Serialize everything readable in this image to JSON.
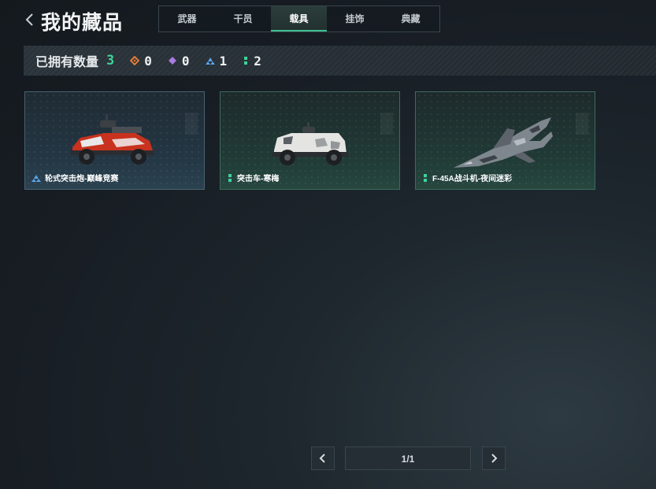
{
  "header": {
    "title": "我的藏品",
    "back_icon": "chevron-left-icon"
  },
  "tabs": [
    {
      "label": "武器",
      "active": false
    },
    {
      "label": "干员",
      "active": false
    },
    {
      "label": "载具",
      "active": true
    },
    {
      "label": "挂饰",
      "active": false
    },
    {
      "label": "典藏",
      "active": false
    }
  ],
  "stats": {
    "label": "已拥有数量",
    "total": "3",
    "rarities": [
      {
        "icon": "orange-diamond-icon",
        "color": "#e07a3a",
        "count": "0"
      },
      {
        "icon": "purple-diamond-icon",
        "color": "#a97be0",
        "count": "0"
      },
      {
        "icon": "blue-triangle-icon",
        "color": "#5aa3e8",
        "count": "1"
      },
      {
        "icon": "green-dots-icon",
        "color": "#3fd29a",
        "count": "2"
      }
    ]
  },
  "items": [
    {
      "name": "轮式突击炮-巅峰竞赛",
      "rarity": "blue",
      "rarity_icon": "blue-triangle-icon",
      "image": "red-armored-vehicle-icon"
    },
    {
      "name": "突击车-寒梅",
      "rarity": "green",
      "rarity_icon": "green-dots-icon",
      "image": "white-camo-vehicle-icon"
    },
    {
      "name": "F-45A战斗机-夜间迷彩",
      "rarity": "green",
      "rarity_icon": "green-dots-icon",
      "image": "camo-fighter-jet-icon"
    }
  ],
  "pagination": {
    "text": "1/1"
  },
  "colors": {
    "accent_green": "#3fd29a",
    "rarity_blue": "#5aa3e8",
    "rarity_green": "#3fd29a"
  }
}
